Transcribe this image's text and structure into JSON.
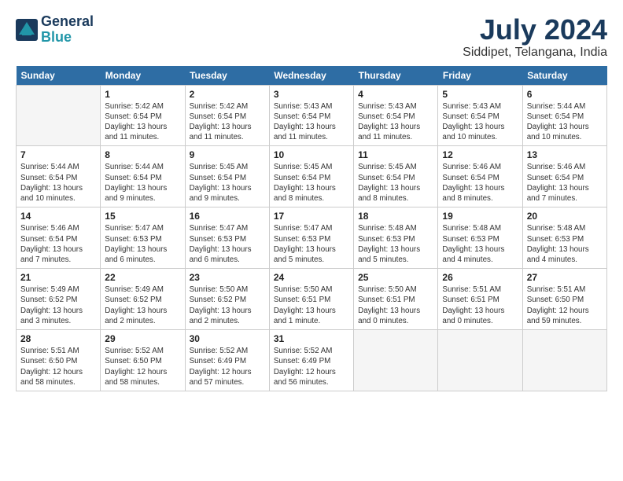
{
  "header": {
    "logo_line1": "General",
    "logo_line2": "Blue",
    "month_year": "July 2024",
    "location": "Siddipet, Telangana, India"
  },
  "weekdays": [
    "Sunday",
    "Monday",
    "Tuesday",
    "Wednesday",
    "Thursday",
    "Friday",
    "Saturday"
  ],
  "weeks": [
    [
      {
        "day": "",
        "empty": true
      },
      {
        "day": "1",
        "sunrise": "Sunrise: 5:42 AM",
        "sunset": "Sunset: 6:54 PM",
        "daylight": "Daylight: 13 hours and 11 minutes."
      },
      {
        "day": "2",
        "sunrise": "Sunrise: 5:42 AM",
        "sunset": "Sunset: 6:54 PM",
        "daylight": "Daylight: 13 hours and 11 minutes."
      },
      {
        "day": "3",
        "sunrise": "Sunrise: 5:43 AM",
        "sunset": "Sunset: 6:54 PM",
        "daylight": "Daylight: 13 hours and 11 minutes."
      },
      {
        "day": "4",
        "sunrise": "Sunrise: 5:43 AM",
        "sunset": "Sunset: 6:54 PM",
        "daylight": "Daylight: 13 hours and 11 minutes."
      },
      {
        "day": "5",
        "sunrise": "Sunrise: 5:43 AM",
        "sunset": "Sunset: 6:54 PM",
        "daylight": "Daylight: 13 hours and 10 minutes."
      },
      {
        "day": "6",
        "sunrise": "Sunrise: 5:44 AM",
        "sunset": "Sunset: 6:54 PM",
        "daylight": "Daylight: 13 hours and 10 minutes."
      }
    ],
    [
      {
        "day": "7",
        "sunrise": "Sunrise: 5:44 AM",
        "sunset": "Sunset: 6:54 PM",
        "daylight": "Daylight: 13 hours and 10 minutes."
      },
      {
        "day": "8",
        "sunrise": "Sunrise: 5:44 AM",
        "sunset": "Sunset: 6:54 PM",
        "daylight": "Daylight: 13 hours and 9 minutes."
      },
      {
        "day": "9",
        "sunrise": "Sunrise: 5:45 AM",
        "sunset": "Sunset: 6:54 PM",
        "daylight": "Daylight: 13 hours and 9 minutes."
      },
      {
        "day": "10",
        "sunrise": "Sunrise: 5:45 AM",
        "sunset": "Sunset: 6:54 PM",
        "daylight": "Daylight: 13 hours and 8 minutes."
      },
      {
        "day": "11",
        "sunrise": "Sunrise: 5:45 AM",
        "sunset": "Sunset: 6:54 PM",
        "daylight": "Daylight: 13 hours and 8 minutes."
      },
      {
        "day": "12",
        "sunrise": "Sunrise: 5:46 AM",
        "sunset": "Sunset: 6:54 PM",
        "daylight": "Daylight: 13 hours and 8 minutes."
      },
      {
        "day": "13",
        "sunrise": "Sunrise: 5:46 AM",
        "sunset": "Sunset: 6:54 PM",
        "daylight": "Daylight: 13 hours and 7 minutes."
      }
    ],
    [
      {
        "day": "14",
        "sunrise": "Sunrise: 5:46 AM",
        "sunset": "Sunset: 6:54 PM",
        "daylight": "Daylight: 13 hours and 7 minutes."
      },
      {
        "day": "15",
        "sunrise": "Sunrise: 5:47 AM",
        "sunset": "Sunset: 6:53 PM",
        "daylight": "Daylight: 13 hours and 6 minutes."
      },
      {
        "day": "16",
        "sunrise": "Sunrise: 5:47 AM",
        "sunset": "Sunset: 6:53 PM",
        "daylight": "Daylight: 13 hours and 6 minutes."
      },
      {
        "day": "17",
        "sunrise": "Sunrise: 5:47 AM",
        "sunset": "Sunset: 6:53 PM",
        "daylight": "Daylight: 13 hours and 5 minutes."
      },
      {
        "day": "18",
        "sunrise": "Sunrise: 5:48 AM",
        "sunset": "Sunset: 6:53 PM",
        "daylight": "Daylight: 13 hours and 5 minutes."
      },
      {
        "day": "19",
        "sunrise": "Sunrise: 5:48 AM",
        "sunset": "Sunset: 6:53 PM",
        "daylight": "Daylight: 13 hours and 4 minutes."
      },
      {
        "day": "20",
        "sunrise": "Sunrise: 5:48 AM",
        "sunset": "Sunset: 6:53 PM",
        "daylight": "Daylight: 13 hours and 4 minutes."
      }
    ],
    [
      {
        "day": "21",
        "sunrise": "Sunrise: 5:49 AM",
        "sunset": "Sunset: 6:52 PM",
        "daylight": "Daylight: 13 hours and 3 minutes."
      },
      {
        "day": "22",
        "sunrise": "Sunrise: 5:49 AM",
        "sunset": "Sunset: 6:52 PM",
        "daylight": "Daylight: 13 hours and 2 minutes."
      },
      {
        "day": "23",
        "sunrise": "Sunrise: 5:50 AM",
        "sunset": "Sunset: 6:52 PM",
        "daylight": "Daylight: 13 hours and 2 minutes."
      },
      {
        "day": "24",
        "sunrise": "Sunrise: 5:50 AM",
        "sunset": "Sunset: 6:51 PM",
        "daylight": "Daylight: 13 hours and 1 minute."
      },
      {
        "day": "25",
        "sunrise": "Sunrise: 5:50 AM",
        "sunset": "Sunset: 6:51 PM",
        "daylight": "Daylight: 13 hours and 0 minutes."
      },
      {
        "day": "26",
        "sunrise": "Sunrise: 5:51 AM",
        "sunset": "Sunset: 6:51 PM",
        "daylight": "Daylight: 13 hours and 0 minutes."
      },
      {
        "day": "27",
        "sunrise": "Sunrise: 5:51 AM",
        "sunset": "Sunset: 6:50 PM",
        "daylight": "Daylight: 12 hours and 59 minutes."
      }
    ],
    [
      {
        "day": "28",
        "sunrise": "Sunrise: 5:51 AM",
        "sunset": "Sunset: 6:50 PM",
        "daylight": "Daylight: 12 hours and 58 minutes."
      },
      {
        "day": "29",
        "sunrise": "Sunrise: 5:52 AM",
        "sunset": "Sunset: 6:50 PM",
        "daylight": "Daylight: 12 hours and 58 minutes."
      },
      {
        "day": "30",
        "sunrise": "Sunrise: 5:52 AM",
        "sunset": "Sunset: 6:49 PM",
        "daylight": "Daylight: 12 hours and 57 minutes."
      },
      {
        "day": "31",
        "sunrise": "Sunrise: 5:52 AM",
        "sunset": "Sunset: 6:49 PM",
        "daylight": "Daylight: 12 hours and 56 minutes."
      },
      {
        "day": "",
        "empty": true
      },
      {
        "day": "",
        "empty": true
      },
      {
        "day": "",
        "empty": true
      }
    ]
  ]
}
